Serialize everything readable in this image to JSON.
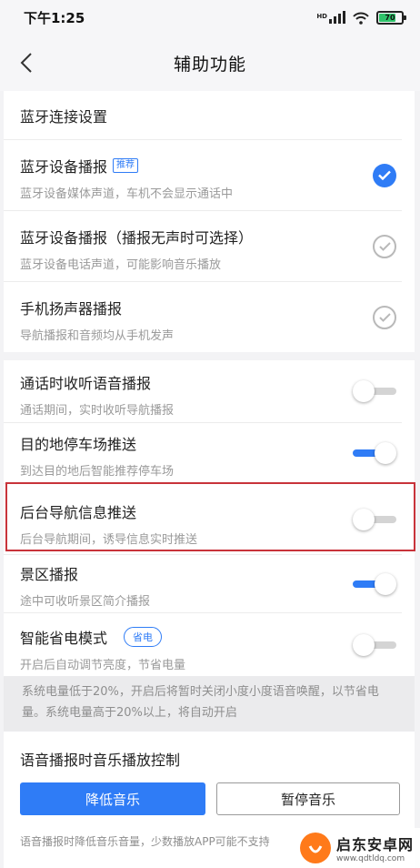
{
  "status_bar": {
    "time": "下午1:25",
    "network": "HD",
    "battery": "70"
  },
  "nav": {
    "title": "辅助功能"
  },
  "bluetooth": {
    "header": "蓝牙连接设置",
    "options": [
      {
        "title": "蓝牙设备播报",
        "tag": "推荐",
        "subtitle": "蓝牙设备媒体声道，车机不会显示通话中",
        "selected": true
      },
      {
        "title": "蓝牙设备播报（播报无声时可选择）",
        "subtitle": "蓝牙设备电话声道，可能影响音乐播放",
        "selected": false
      },
      {
        "title": "手机扬声器播报",
        "subtitle": "导航播报和音频均从手机发声",
        "selected": false
      }
    ]
  },
  "settings": {
    "items": [
      {
        "title": "通话时收听语音播报",
        "subtitle": "通话期间，实时收听导航播报",
        "on": false
      },
      {
        "title": "目的地停车场推送",
        "subtitle": "到达目的地后智能推荐停车场",
        "on": true
      },
      {
        "title": "后台导航信息推送",
        "subtitle": "后台导航期间，诱导信息实时推送",
        "on": false
      },
      {
        "title": "景区播报",
        "subtitle": "途中可收听景区简介播报",
        "on": true
      },
      {
        "title": "智能省电模式",
        "tag": "省电",
        "subtitle": "开启后自动调节亮度，节省电量",
        "on": false
      }
    ],
    "note": "系统电量低于20%，开启后将暂时关闭小度小度语音唤醒，以节省电量。系统电量高于20%以上，将自动开启"
  },
  "music_control": {
    "title": "语音播报时音乐播放控制",
    "lower_label": "降低音乐",
    "pause_label": "暂停音乐",
    "description": "语音播报时降低音乐音量，少数播放APP可能不支持"
  },
  "watermark": {
    "name": "启东安卓网",
    "url": "www.qdtldq.com"
  },
  "colors": {
    "accent": "#2f7cf6",
    "highlight": "#c8333a"
  }
}
